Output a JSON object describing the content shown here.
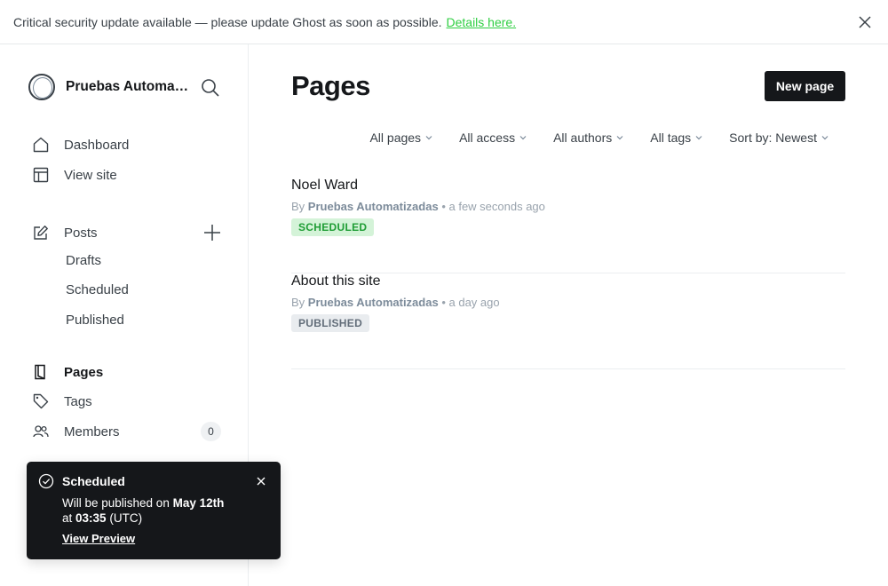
{
  "banner": {
    "message": "Critical security update available — please update Ghost as soon as possible.",
    "link": "Details here."
  },
  "sidebar": {
    "site_name": "Pruebas Automatizadas",
    "nav": [
      {
        "label": "Dashboard",
        "icon": "home-icon"
      },
      {
        "label": "View site",
        "icon": "browser-icon"
      }
    ],
    "posts_label": "Posts",
    "posts_sub": [
      "Drafts",
      "Scheduled",
      "Published"
    ],
    "pages_label": "Pages",
    "tags_label": "Tags",
    "members_label": "Members",
    "members_count": "0"
  },
  "main": {
    "title": "Pages",
    "new_button": "New page",
    "filters": [
      "All pages",
      "All access",
      "All authors",
      "All tags",
      "Sort by: Newest"
    ],
    "items": [
      {
        "title": "Noel Ward",
        "by": "By",
        "author": "Pruebas Automatizadas",
        "time": "• a few seconds ago",
        "status": "SCHEDULED"
      },
      {
        "title": "About this site",
        "by": "By",
        "author": "Pruebas Automatizadas",
        "time": "• a day ago",
        "status": "PUBLISHED"
      }
    ]
  },
  "toast": {
    "title": "Scheduled",
    "body_prefix": "Will be published on",
    "date": "May 12th",
    "at": "at",
    "time": "03:35",
    "tz": "(UTC)",
    "link": "View Preview"
  },
  "colors": {
    "accent_green": "#30cf43",
    "dark": "#15171a"
  }
}
